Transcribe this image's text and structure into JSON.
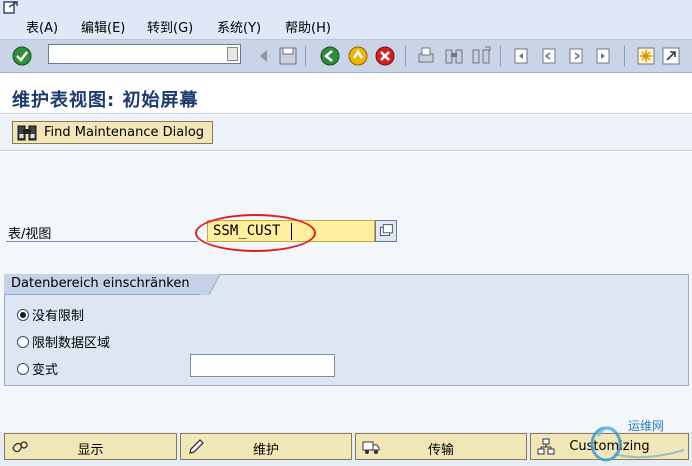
{
  "menu": [
    {
      "label": "表(A)",
      "id": "table"
    },
    {
      "label": "编辑(E)",
      "id": "edit"
    },
    {
      "label": "转到(G)",
      "id": "goto"
    },
    {
      "label": "系统(Y)",
      "id": "system"
    },
    {
      "label": "帮助(H)",
      "id": "help"
    }
  ],
  "toolbar": {
    "command_field_value": "",
    "icons": [
      "enter-icon",
      "back-icon",
      "save-icon",
      "back-green-icon",
      "exit-icon",
      "cancel-icon",
      "print-icon",
      "find-icon",
      "find-next-icon",
      "first-page-icon",
      "previous-page-icon",
      "next-page-icon",
      "last-page-icon",
      "create-session-icon",
      "shortcut-icon"
    ]
  },
  "title": "维护表视图: 初始屏幕",
  "app_toolbar": {
    "find_dialog_label": "Find Maintenance Dialog"
  },
  "form": {
    "table_view_label": "表/视图",
    "table_view_value": "SSM_CUST"
  },
  "restrict": {
    "group_title": "Datenbereich einschränken",
    "options": [
      {
        "label": "没有限制",
        "selected": true
      },
      {
        "label": "限制数据区域",
        "selected": false
      },
      {
        "label": "变式",
        "selected": false
      }
    ],
    "variant_value": ""
  },
  "actions": [
    {
      "label": "显示",
      "icon": "display-icon"
    },
    {
      "label": "维护",
      "icon": "pencil-icon"
    },
    {
      "label": "传输",
      "icon": "truck-icon"
    },
    {
      "label": "Customizing",
      "icon": "hierarchy-icon"
    }
  ],
  "watermark": {
    "text": "运维网"
  },
  "colors": {
    "highlight_circle": "#dd1f1f",
    "title_text": "#1c3a6e",
    "input_required": "#ffef9f",
    "button_fill": "#f1e6b8"
  }
}
